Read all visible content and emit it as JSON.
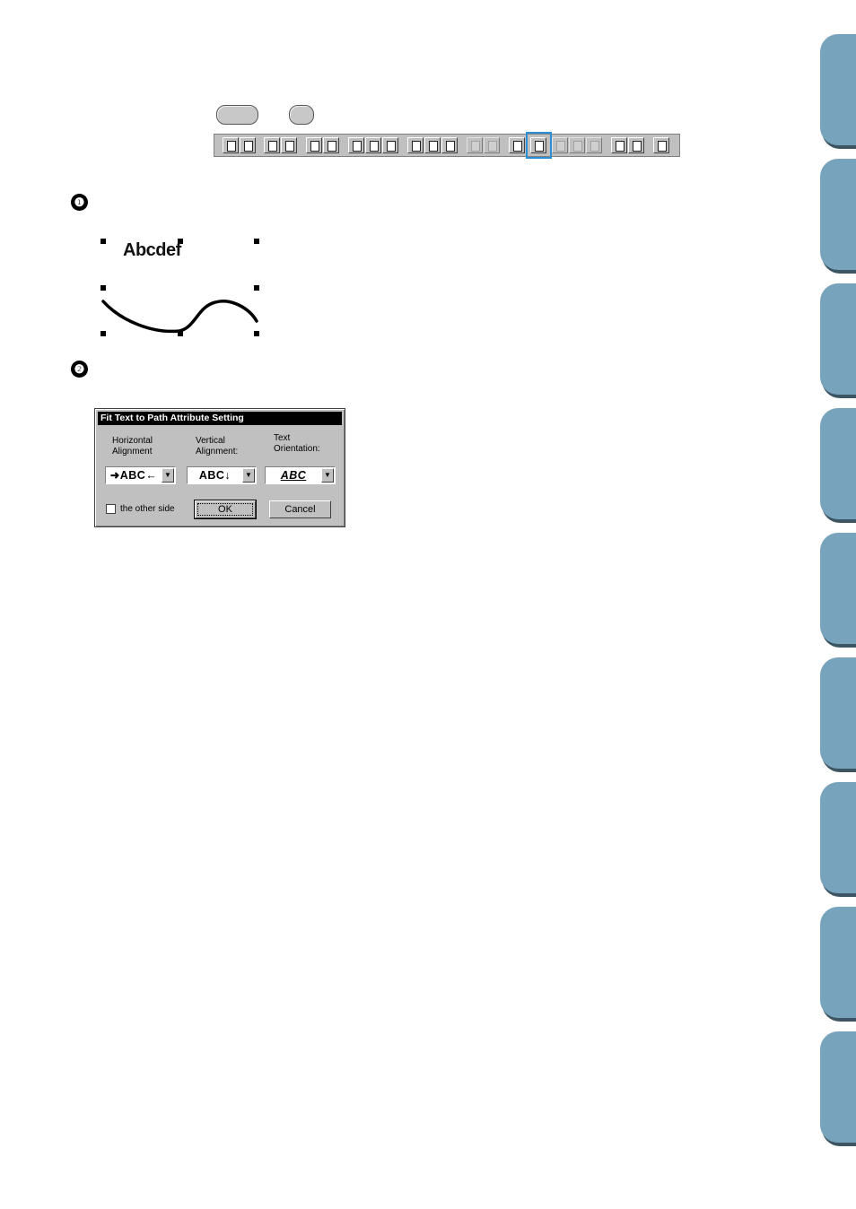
{
  "toolbar": {
    "buttons": [
      "new-file-icon",
      "open-file-icon",
      "import-icon",
      "export-icon",
      "save-icon",
      "save-as-icon",
      "cut-icon",
      "copy-icon",
      "paste-icon",
      "mirror-horizontal-icon",
      "mirror-vertical-icon",
      "rotate-icon",
      "group-icon",
      "ungroup-icon",
      "text-icon",
      "fit-text-to-path-icon",
      "text-disabled-1-icon",
      "text-disabled-2-icon",
      "text-disabled-3-icon",
      "stitch-icon",
      "sew-order-icon",
      "preview-icon"
    ],
    "highlighted": "fit-text-to-path-icon"
  },
  "steps": [
    "❶",
    "❷"
  ],
  "illustration": {
    "text": "Abcdef"
  },
  "dialog": {
    "title": "Fit Text to Path Attribute Setting",
    "horizontal_label": "Horizontal\nAlignment",
    "vertical_label": "Vertical\nAlignment:",
    "orientation_label": "Text\nOrientation:",
    "horizontal_value": "➜ABC←",
    "vertical_value": "ABC↓",
    "orientation_value": "ABC",
    "checkbox_label": "the other side",
    "checkbox_checked": false,
    "ok_label": "OK",
    "cancel_label": "Cancel"
  },
  "colors": {
    "side_tab": "#78a3bc",
    "highlight": "#2a8fd6",
    "window_face": "#c0c0c0"
  }
}
